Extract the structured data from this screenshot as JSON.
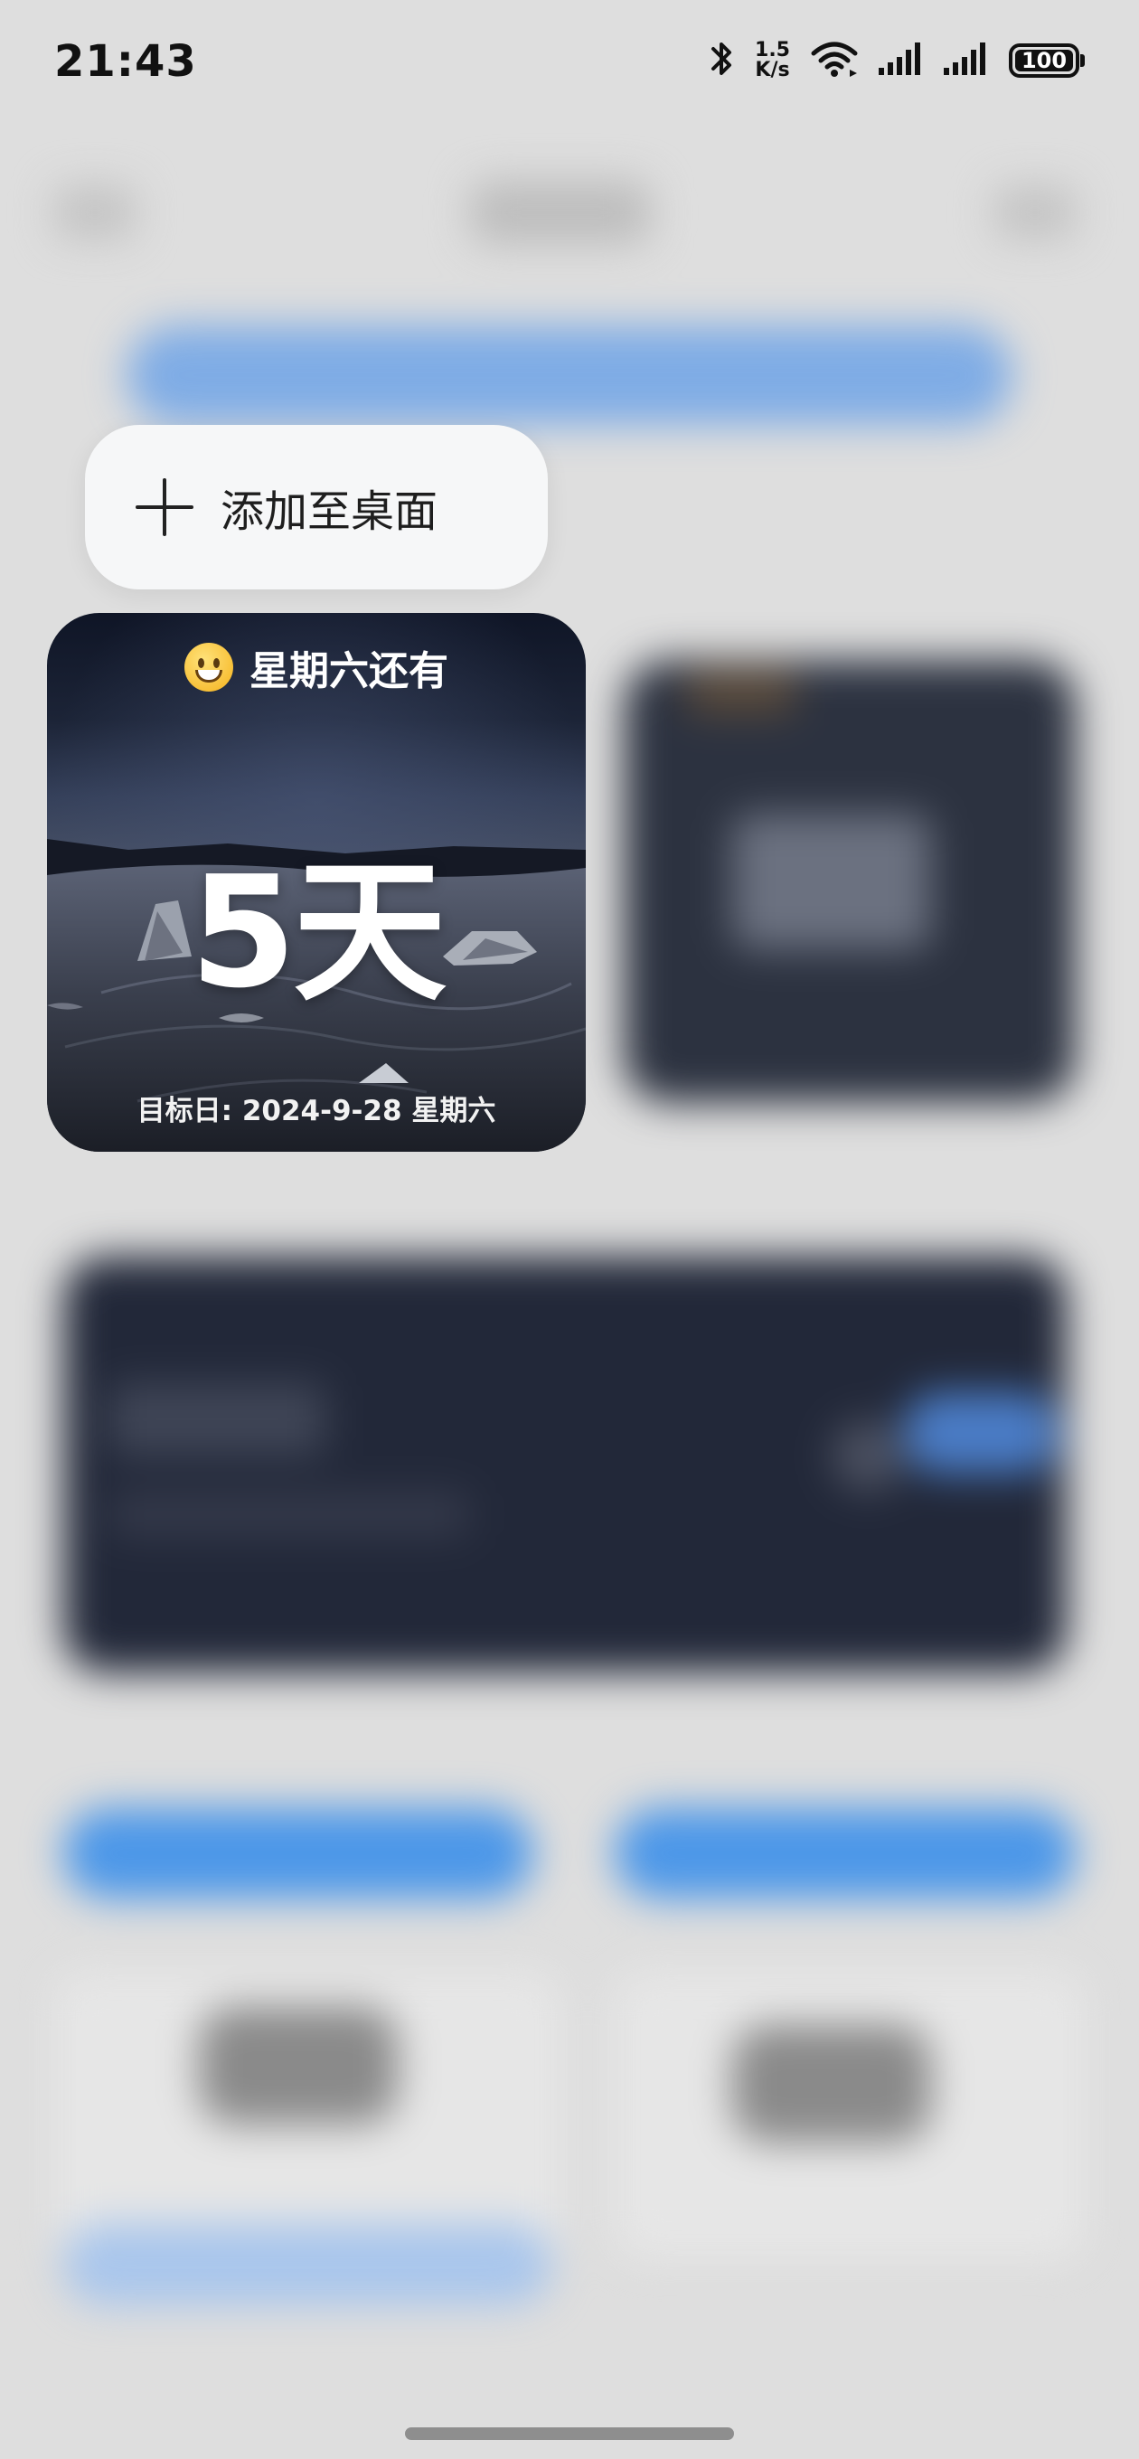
{
  "status_bar": {
    "time": "21:43",
    "net_speed_value": "1.5",
    "net_speed_unit": "K/s",
    "battery": "100",
    "icons": [
      "bluetooth-icon",
      "wifi-icon",
      "signal-icon",
      "signal-icon",
      "battery-icon"
    ]
  },
  "popup": {
    "add_to_desktop_label": "添加至桌面",
    "icon": "plus-icon"
  },
  "widget": {
    "emoji_icon": "grinning-face-icon",
    "title": "星期六还有",
    "days": "5天",
    "target_date": "目标日: 2024-9-28 星期六"
  },
  "colors": {
    "popup_bg": "#f6f7f8",
    "accent_blue": "#4c97e8",
    "background": "#dedede"
  }
}
